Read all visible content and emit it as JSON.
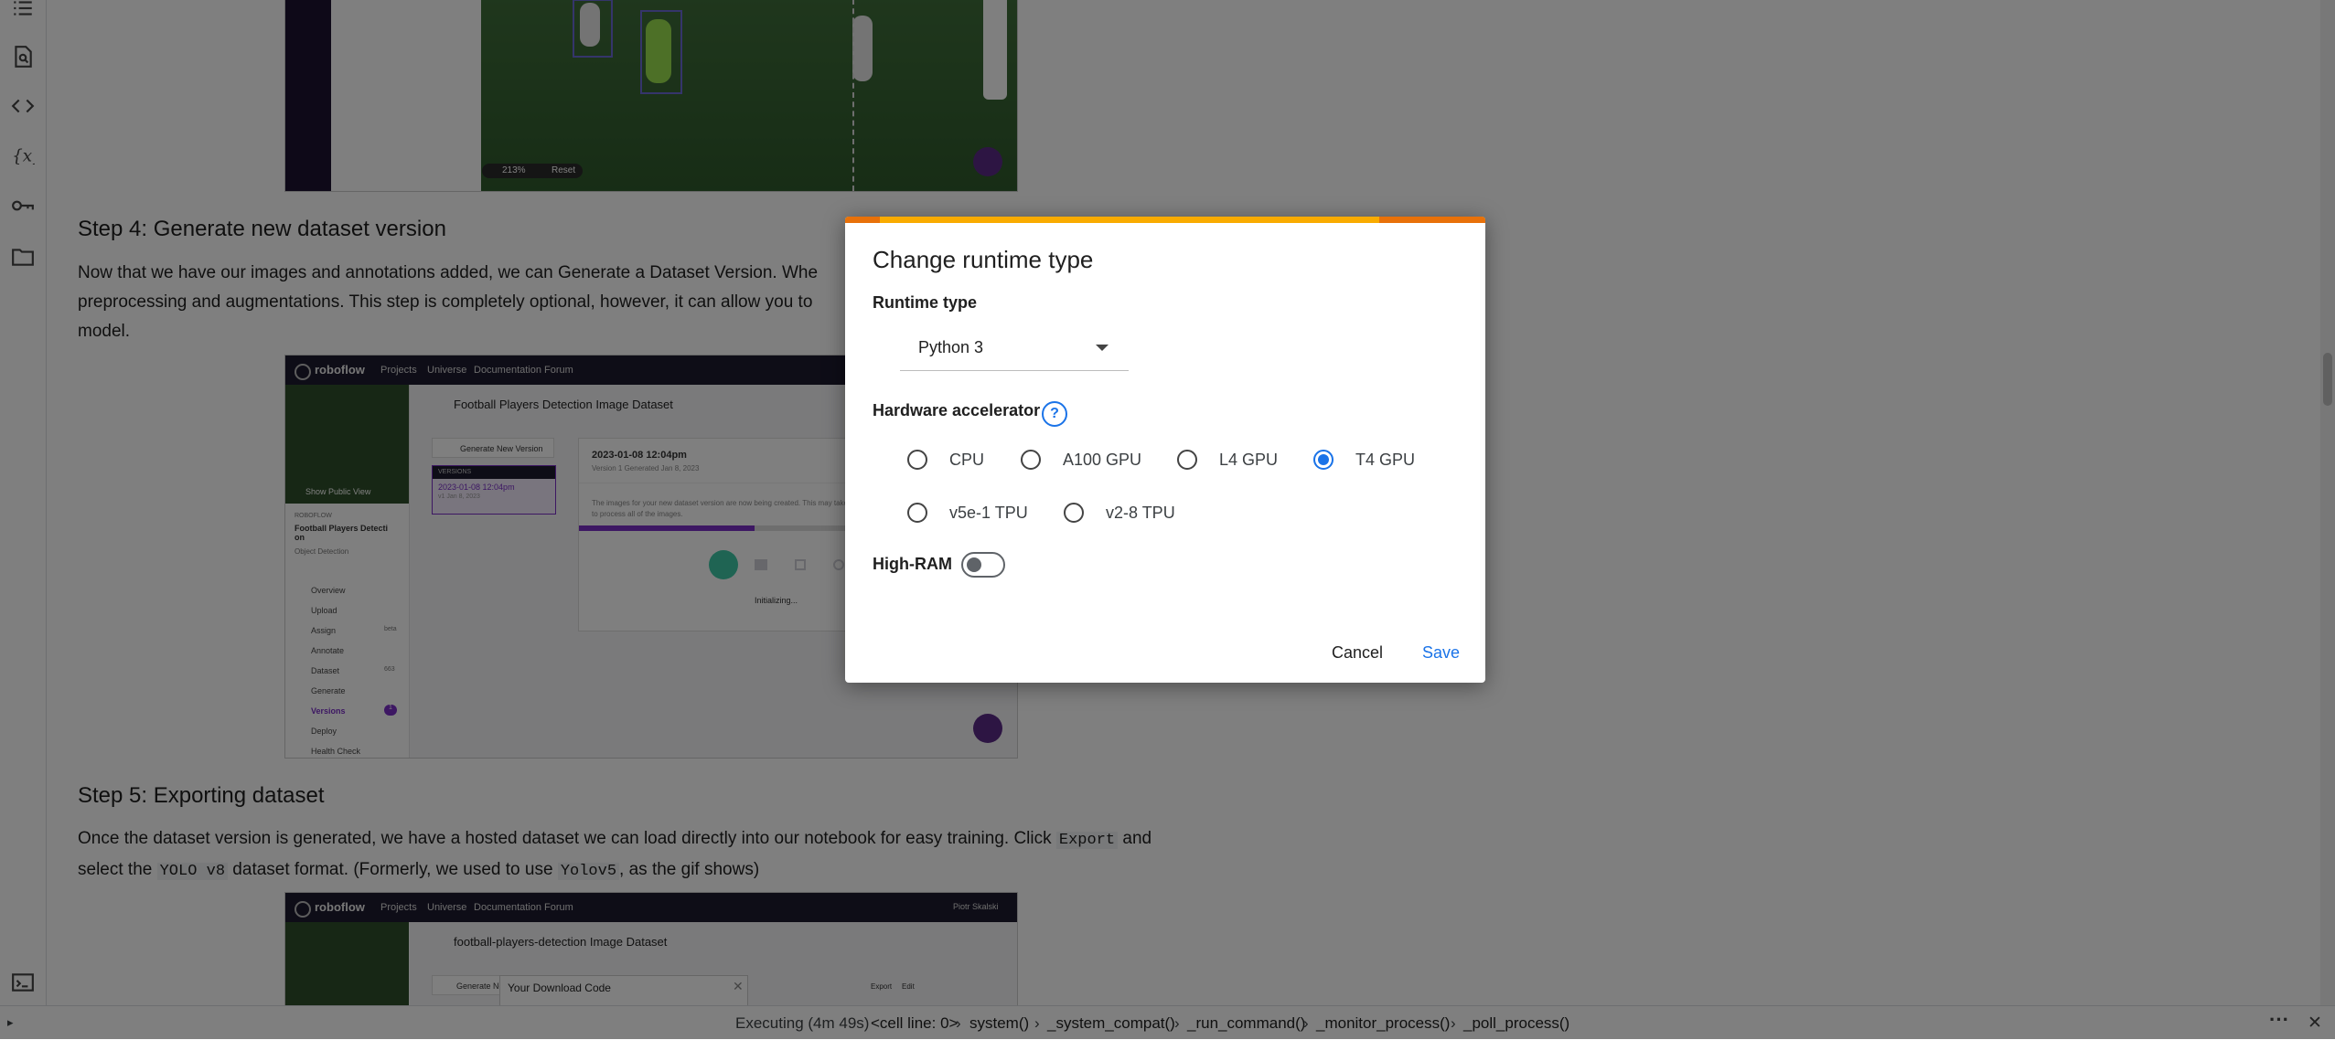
{
  "rail": {
    "icons": [
      "table-of-contents-icon",
      "find-icon",
      "code-snippets-icon",
      "variables-icon",
      "secrets-icon",
      "files-icon",
      "terminal-icon"
    ]
  },
  "notebook": {
    "step4": {
      "heading": "Step 4: Generate new dataset version",
      "para_line1": "Now that we have our images and annotations added, we can Generate a Dataset Version. Whe",
      "para_line2": "preprocessing and augmentations. This step is completely optional, however, it can allow you to",
      "para_line3": "model."
    },
    "step5": {
      "heading": "Step 5: Exporting dataset",
      "para_a": "Once the dataset version is generated, we have a hosted dataset we can load directly into our notebook for easy training. Click ",
      "code_export": "Export",
      "para_b": " and",
      "para_c": "select the ",
      "code_yolov8": "YOLO v8",
      "para_d": " dataset format. (Formerly, we used to use ",
      "code_yolov5": "Yolov5",
      "para_e": ", as the gif shows)"
    },
    "shot1": {
      "zoom": "213%",
      "reset": "Reset"
    },
    "shot2": {
      "brand": "roboflow",
      "nav": [
        "Projects",
        "Universe",
        "Documentation",
        "Forum"
      ],
      "dataset_title": "Football Players Detection Image Dataset",
      "generate_btn": "Generate New Version",
      "versions_label": "VERSIONS",
      "version_name": "2023-01-08 12:04pm",
      "version_sub": "v1 Jan 8, 2023",
      "card_title": "2023-01-08 12:04pm",
      "card_sub": "Version 1 Generated Jan 8, 2023",
      "card_text": "The images for your new dataset version are now being created. This may take",
      "card_text2": "to process all of the images.",
      "status": "Initializing...",
      "show_public": "Show Public View",
      "workspace": "ROBOFLOW",
      "project_name": "Football Players Detecti on",
      "project_type": "Object Detection",
      "menu": [
        "Overview",
        "Upload",
        "Assign",
        "Annotate",
        "Dataset",
        "Generate",
        "Versions",
        "Deploy",
        "Health Check"
      ],
      "menu_badges": {
        "Assign": "beta",
        "Dataset": "663",
        "Versions": "1"
      }
    },
    "shot3": {
      "brand": "roboflow",
      "nav": [
        "Projects",
        "Universe",
        "Documentation",
        "Forum"
      ],
      "user": "Piotr Skalski",
      "dataset_title": "football-players-detection Image Dataset",
      "generate_btn": "Generate New",
      "download_title": "Your Download Code",
      "export_btn": "Export",
      "edit_btn": "Edit"
    }
  },
  "dialog": {
    "title": "Change runtime type",
    "runtime_label": "Runtime type",
    "runtime_value": "Python 3",
    "accelerator_label": "Hardware accelerator",
    "accelerators": [
      {
        "label": "CPU",
        "selected": false
      },
      {
        "label": "A100 GPU",
        "selected": false
      },
      {
        "label": "L4 GPU",
        "selected": false
      },
      {
        "label": "T4 GPU",
        "selected": true
      },
      {
        "label": "v5e-1 TPU",
        "selected": false
      },
      {
        "label": "v2-8 TPU",
        "selected": false
      }
    ],
    "highram_label": "High-RAM",
    "highram_on": false,
    "cancel": "Cancel",
    "save": "Save",
    "colors": {
      "accent": "#1a73e8",
      "bar": "#f9ab00",
      "bar_edge": "#e8710a"
    }
  },
  "statusbar": {
    "executing": "Executing (4m 49s)",
    "trace": [
      "<cell line: 0>",
      "system()",
      "_system_compat()",
      "_run_command()",
      "_monitor_process()",
      "_poll_process()"
    ]
  }
}
